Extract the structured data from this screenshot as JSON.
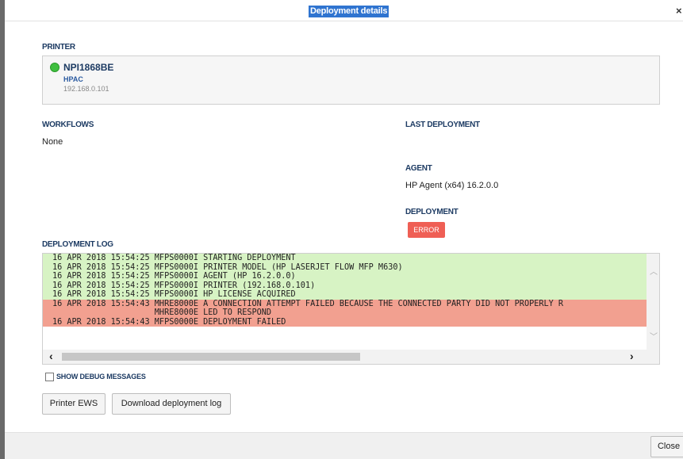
{
  "dialog": {
    "title": "Deployment details",
    "close_glyph": "×"
  },
  "printer": {
    "label": "PRINTER",
    "name": "NPI1868BE",
    "model": "HPAC",
    "ip": "192.168.0.101",
    "status_color": "#3fbf3f"
  },
  "workflows": {
    "label": "WORKFLOWS",
    "value": "None"
  },
  "last_deployment": {
    "label": "LAST DEPLOYMENT"
  },
  "agent": {
    "label": "AGENT",
    "value": "HP Agent (x64) 16.2.0.0"
  },
  "deployment": {
    "label": "DEPLOYMENT",
    "status": "ERROR",
    "status_color": "#ef5f55"
  },
  "log": {
    "label": "DEPLOYMENT LOG",
    "lines": [
      {
        "text": "16 APR 2018 15:54:25 MFPS0000I STARTING DEPLOYMENT",
        "level": "ok"
      },
      {
        "text": "16 APR 2018 15:54:25 MFPS0000I PRINTER MODEL (HP LASERJET FLOW MFP M630)",
        "level": "ok"
      },
      {
        "text": "16 APR 2018 15:54:25 MFPS0000I AGENT (HP 16.2.0.0)",
        "level": "ok"
      },
      {
        "text": "16 APR 2018 15:54:25 MFPS0000I PRINTER (192.168.0.101)",
        "level": "ok"
      },
      {
        "text": "16 APR 2018 15:54:25 MFPS0000I HP LICENSE ACQUIRED",
        "level": "ok"
      },
      {
        "text": "16 APR 2018 15:54:43 MHRE8000E A CONNECTION ATTEMPT FAILED BECAUSE THE CONNECTED PARTY DID NOT PROPERLY R",
        "level": "err"
      },
      {
        "text": "                     MHRE8000E LED TO RESPOND",
        "level": "err"
      },
      {
        "text": "16 APR 2018 15:54:43 MFPS0000E DEPLOYMENT FAILED",
        "level": "err"
      }
    ],
    "colors": {
      "ok": "#d7f3c4",
      "err": "#f2a090"
    }
  },
  "debug": {
    "label": "SHOW DEBUG MESSAGES",
    "checked": false
  },
  "buttons": {
    "printer_ews": "Printer EWS",
    "download_log": "Download deployment log",
    "close": "Close"
  }
}
